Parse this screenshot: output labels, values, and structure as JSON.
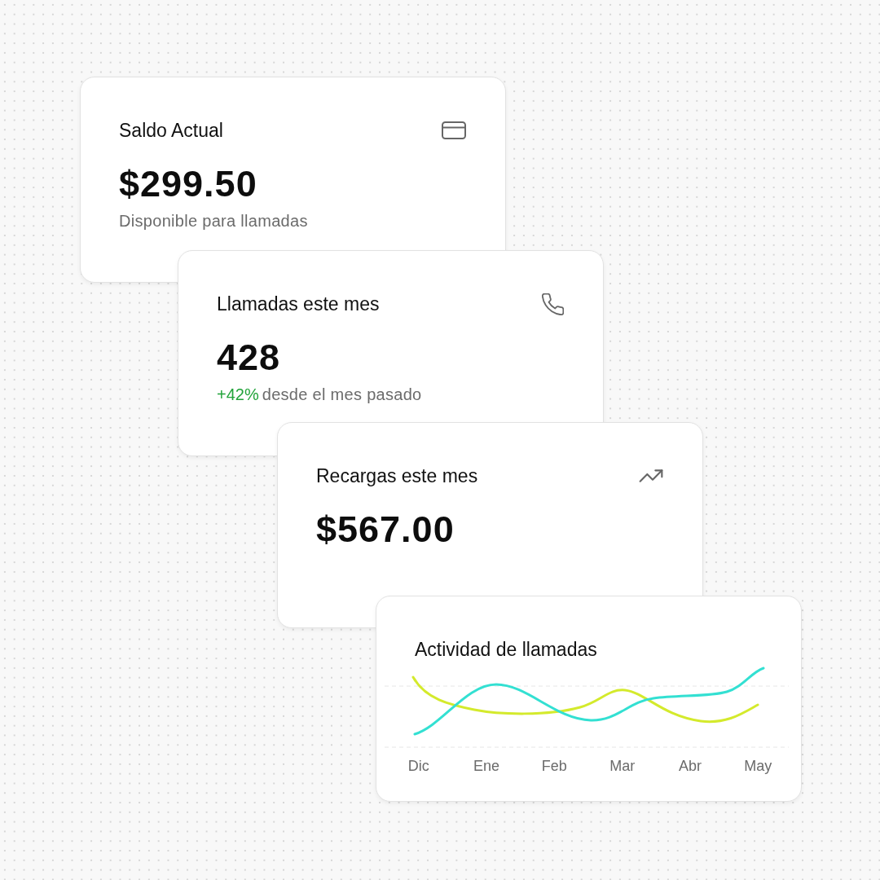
{
  "cards": [
    {
      "kind": "stat",
      "title": "Saldo Actual",
      "value": "$299.50",
      "caption": "Disponible para llamadas"
    },
    {
      "kind": "stat",
      "title": "Llamadas este mes",
      "value": "428",
      "change": "+42%",
      "caption": "desde el mes pasado"
    },
    {
      "kind": "stat",
      "title": "Recargas este mes",
      "value": "$567.00"
    },
    {
      "kind": "chart",
      "title": "Actividad de llamadas",
      "x_labels": [
        "Dic",
        "Ene",
        "Feb",
        "Mar",
        "Abr",
        "May"
      ]
    }
  ]
}
